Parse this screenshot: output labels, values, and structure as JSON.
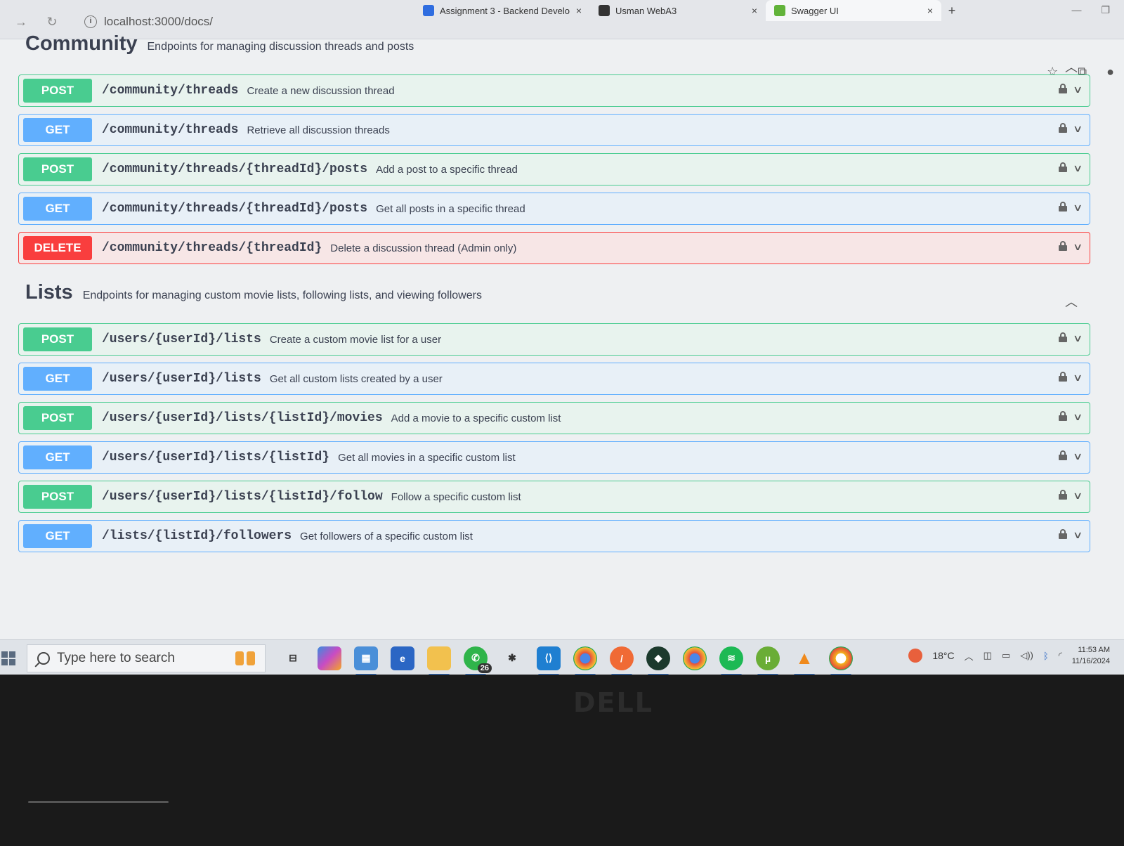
{
  "browser": {
    "tabs": [
      {
        "title": "Assignment 3 - Backend Develo",
        "favicon_color": "#2f6de0",
        "active": false
      },
      {
        "title": "Usman WebA3",
        "favicon_color": "#333333",
        "active": false
      },
      {
        "title": "Swagger UI",
        "favicon_color": "#62b33a",
        "active": true
      }
    ],
    "new_tab": "+",
    "url": "localhost:3000/docs/",
    "close_glyph": "×"
  },
  "sections": {
    "community": {
      "title": "Community",
      "description": "Endpoints for managing discussion threads and posts",
      "operations": [
        {
          "method": "POST",
          "path": "/community/threads",
          "summary": "Create a new discussion thread"
        },
        {
          "method": "GET",
          "path": "/community/threads",
          "summary": "Retrieve all discussion threads"
        },
        {
          "method": "POST",
          "path": "/community/threads/{threadId}/posts",
          "summary": "Add a post to a specific thread"
        },
        {
          "method": "GET",
          "path": "/community/threads/{threadId}/posts",
          "summary": "Get all posts in a specific thread"
        },
        {
          "method": "DELETE",
          "path": "/community/threads/{threadId}",
          "summary": "Delete a discussion thread (Admin only)"
        }
      ]
    },
    "lists": {
      "title": "Lists",
      "description": "Endpoints for managing custom movie lists, following lists, and viewing followers",
      "operations": [
        {
          "method": "POST",
          "path": "/users/{userId}/lists",
          "summary": "Create a custom movie list for a user"
        },
        {
          "method": "GET",
          "path": "/users/{userId}/lists",
          "summary": "Get all custom lists created by a user"
        },
        {
          "method": "POST",
          "path": "/users/{userId}/lists/{listId}/movies",
          "summary": "Add a movie to a specific custom list"
        },
        {
          "method": "GET",
          "path": "/users/{userId}/lists/{listId}",
          "summary": "Get all movies in a specific custom list"
        },
        {
          "method": "POST",
          "path": "/users/{userId}/lists/{listId}/follow",
          "summary": "Follow a specific custom list"
        },
        {
          "method": "GET",
          "path": "/lists/{listId}/followers",
          "summary": "Get followers of a specific custom list"
        }
      ]
    }
  },
  "taskbar": {
    "search_placeholder": "Type here to search",
    "whatsapp_badge": "26",
    "temperature": "18°C",
    "time": "11:53 AM",
    "date": "11/16/2024"
  },
  "hardware": {
    "brand": "DELL"
  },
  "colors": {
    "post": "#49cc90",
    "get": "#61affe",
    "delete": "#f93e3e"
  }
}
